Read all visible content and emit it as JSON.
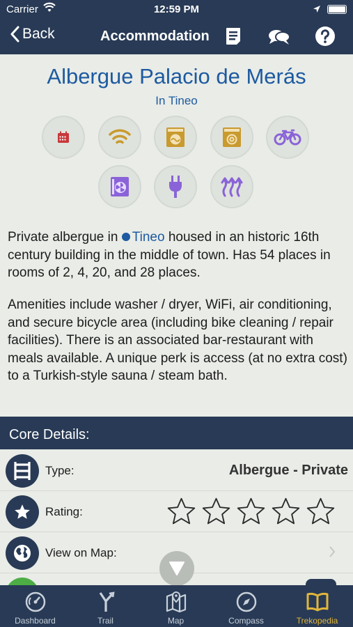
{
  "status": {
    "carrier": "Carrier",
    "time": "12:59 PM"
  },
  "nav": {
    "back_label": "Back",
    "title": "Accommodation"
  },
  "place": {
    "name": "Albergue Palacio de Merás",
    "location": "In Tineo"
  },
  "amenities": [
    "calendar-icon",
    "wifi-icon",
    "washer-icon",
    "dryer-icon",
    "bicycle-icon",
    "air-conditioning-icon",
    "power-plug-icon",
    "heating-icon"
  ],
  "description": {
    "p1_before": "Private albergue in ",
    "p1_link": "Tineo",
    "p1_after": " housed in an historic 16th century building in the middle of town. Has 54 places in rooms of 2, 4, 20, and 28 places.",
    "p2": "Amenities include washer / dryer, WiFi, air conditioning, and secure bicycle area (including bike cleaning / repair facilities). There is an associated bar-restaurant with meals available. A unique perk is access (at no extra cost) to a Turkish-style sauna / steam bath."
  },
  "core": {
    "header": "Core Details:",
    "type_label": "Type:",
    "type_value": "Albergue - Private",
    "rating_label": "Rating:",
    "rating_value": 0,
    "rating_max": 5,
    "map_label": "View on Map:"
  },
  "tabs": [
    {
      "label": "Dashboard",
      "icon": "gauge-icon"
    },
    {
      "label": "Trail",
      "icon": "trail-sign-icon"
    },
    {
      "label": "Map",
      "icon": "map-icon"
    },
    {
      "label": "Compass",
      "icon": "compass-icon"
    },
    {
      "label": "Trekopedia",
      "icon": "book-icon"
    }
  ],
  "colors": {
    "bar": "#283a55",
    "link": "#1d5aa0",
    "active_tab": "#e2b63c",
    "amenity_red": "#c7383b",
    "amenity_gold": "#c99a2e",
    "amenity_purple": "#8a63d8"
  }
}
